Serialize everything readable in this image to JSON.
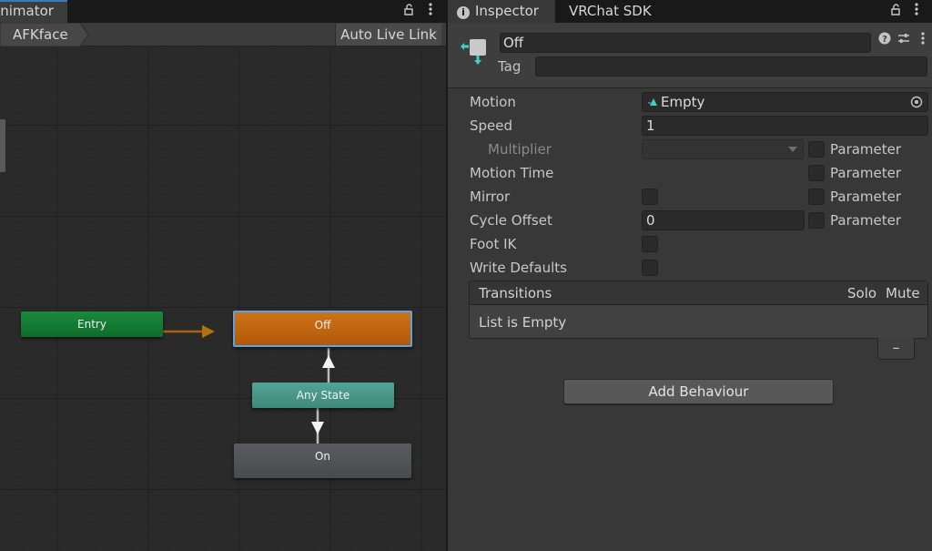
{
  "animator": {
    "tab_label": "Animator",
    "lock_icon": "lock-icon",
    "menu_icon": "kebab-menu-icon",
    "breadcrumb": "AFKface",
    "auto_live_link": "Auto Live Link",
    "nodes": {
      "entry": "Entry",
      "off": "Off",
      "any_state": "Any State",
      "on": "On"
    },
    "colors": {
      "entry": "#1a8a3d",
      "off": "#c8690f",
      "any_state": "#4c9d8f",
      "on": "#505357",
      "selection": "#5aa3e8",
      "entry_transition": "#a6650d"
    }
  },
  "inspector": {
    "tabs": [
      "Inspector",
      "VRChat SDK"
    ],
    "state_name": "Off",
    "tag_label": "Tag",
    "tag_value": "",
    "help_icon": "help-icon",
    "presets_icon": "presets-icon",
    "menu_icon": "kebab-menu-icon",
    "rows": {
      "motion": {
        "label": "Motion",
        "value": "Empty"
      },
      "speed": {
        "label": "Speed",
        "value": "1"
      },
      "multiplier": {
        "label": "Multiplier",
        "param": "Parameter"
      },
      "motion_time": {
        "label": "Motion Time",
        "param": "Parameter"
      },
      "mirror": {
        "label": "Mirror",
        "param": "Parameter"
      },
      "cycle_offset": {
        "label": "Cycle Offset",
        "value": "0",
        "param": "Parameter"
      },
      "foot_ik": {
        "label": "Foot IK"
      },
      "write_defaults": {
        "label": "Write Defaults"
      }
    },
    "transitions": {
      "title": "Transitions",
      "solo": "Solo",
      "mute": "Mute",
      "empty_text": "List is Empty",
      "remove_symbol": "–"
    },
    "add_behaviour": "Add Behaviour"
  }
}
